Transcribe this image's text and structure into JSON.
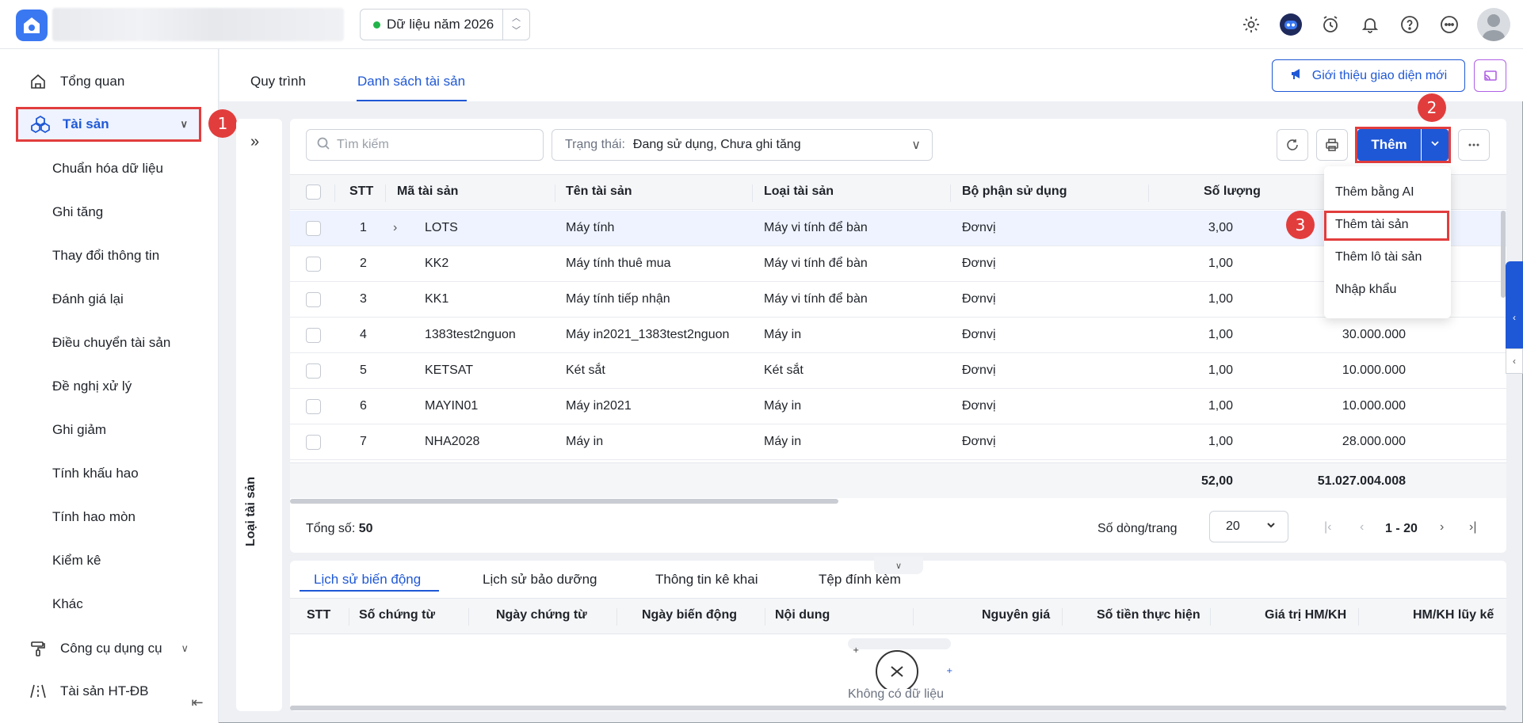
{
  "topbar": {
    "year_label": "Dữ liệu năm 2026"
  },
  "sidebar": {
    "items": [
      {
        "label": "Tổng quan"
      },
      {
        "label": "Tài sản"
      },
      {
        "label": "Công cụ dụng cụ"
      },
      {
        "label": "Tài sản HT-ĐB"
      }
    ],
    "sub_items": [
      "Chuẩn hóa dữ liệu",
      "Ghi tăng",
      "Thay đổi thông tin",
      "Đánh giá lại",
      "Điều chuyển tài sản",
      "Đề nghị xử lý",
      "Ghi giảm",
      "Tính khấu hao",
      "Tính hao mòn",
      "Kiểm kê",
      "Khác"
    ]
  },
  "badges": [
    "1",
    "2",
    "3"
  ],
  "main": {
    "tabs": [
      "Quy trình",
      "Danh sách tài sản"
    ],
    "intro_button": "Giới thiệu giao diện mới",
    "side_panel_label": "Loại tài sản"
  },
  "toolbar": {
    "search_placeholder": "Tìm kiếm",
    "status_key": "Trạng thái:",
    "status_value": "Đang sử dụng, Chưa ghi tăng",
    "add_label": "Thêm"
  },
  "menu": {
    "items": [
      "Thêm bằng AI",
      "Thêm tài sản",
      "Thêm lô tài sản",
      "Nhập khẩu"
    ]
  },
  "table": {
    "headers": [
      "STT",
      "Mã tài sản",
      "Tên tài sản",
      "Loại tài sản",
      "Bộ phận sử dụng",
      "Số lượng"
    ],
    "rows": [
      {
        "stt": "1",
        "code": "LOTS",
        "name": "Máy tính",
        "type": "Máy vi tính để bàn",
        "dept": "Đơnvị",
        "qty": "3,00",
        "value": ""
      },
      {
        "stt": "2",
        "code": "KK2",
        "name": "Máy tính thuê mua",
        "type": "Máy vi tính để bàn",
        "dept": "Đơnvị",
        "qty": "1,00",
        "value": ""
      },
      {
        "stt": "3",
        "code": "KK1",
        "name": "Máy tính tiếp nhận",
        "type": "Máy vi tính để bàn",
        "dept": "Đơnvị",
        "qty": "1,00",
        "value": ""
      },
      {
        "stt": "4",
        "code": "1383test2nguon",
        "name": "Máy in2021_1383test2nguon",
        "type": "Máy in",
        "dept": "Đơnvị",
        "qty": "1,00",
        "value": "30.000.000"
      },
      {
        "stt": "5",
        "code": "KETSAT",
        "name": "Két sắt",
        "type": "Két sắt",
        "dept": "Đơnvị",
        "qty": "1,00",
        "value": "10.000.000"
      },
      {
        "stt": "6",
        "code": "MAYIN01",
        "name": "Máy in2021",
        "type": "Máy in",
        "dept": "Đơnvị",
        "qty": "1,00",
        "value": "10.000.000"
      },
      {
        "stt": "7",
        "code": "NHA2028",
        "name": "Máy in",
        "type": "Máy in",
        "dept": "Đơnvị",
        "qty": "1,00",
        "value": "28.000.000"
      }
    ],
    "total_qty": "52,00",
    "total_value": "51.027.004.008"
  },
  "pager": {
    "total_label": "Tổng số:",
    "total_value": "50",
    "rows_label": "Số dòng/trang",
    "rows_value": "20",
    "range": "1 - 20"
  },
  "bottom": {
    "tabs": [
      "Lịch sử biến động",
      "Lịch sử bảo dưỡng",
      "Thông tin kê khai",
      "Tệp đính kèm"
    ],
    "headers": [
      "STT",
      "Số chứng từ",
      "Ngày chứng từ",
      "Ngày biến động",
      "Nội dung",
      "Nguyên giá",
      "Số tiền thực hiện",
      "Giá trị HM/KH",
      "HM/KH lũy kế"
    ],
    "empty_text": "Không có dữ liệu"
  },
  "colors": {
    "accent": "#1f58d6",
    "highlight": "#e23d3d"
  }
}
